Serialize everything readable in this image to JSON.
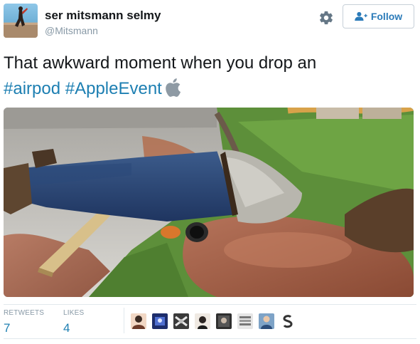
{
  "author": {
    "name": "ser mitsmann selmy",
    "handle": "@Mitsmann"
  },
  "actions": {
    "settings_icon": "gear-icon",
    "follow_label": "Follow",
    "follow_icon": "add-user-icon"
  },
  "tweet": {
    "text_line1": "That awkward moment when you drop an",
    "hashtag1": "#airpod",
    "hashtag2": "#AppleEvent",
    "emoji": "apple-logo-icon"
  },
  "photo": {
    "subject": "man-face-down-in-muddy-puddle"
  },
  "stats": {
    "retweets_label": "RETWEETS",
    "retweets_count": "7",
    "likes_label": "LIKES",
    "likes_count": "4"
  },
  "likers": [
    {
      "icon": "liker-avatar-1"
    },
    {
      "icon": "liker-avatar-2"
    },
    {
      "icon": "liker-avatar-3"
    },
    {
      "icon": "liker-avatar-4"
    },
    {
      "icon": "liker-avatar-5"
    },
    {
      "icon": "liker-avatar-6"
    },
    {
      "icon": "liker-avatar-7"
    },
    {
      "icon": "liker-avatar-8"
    }
  ],
  "colors": {
    "link": "#1d7fb2",
    "muted": "#8899a6",
    "border": "#e1e8ed"
  }
}
